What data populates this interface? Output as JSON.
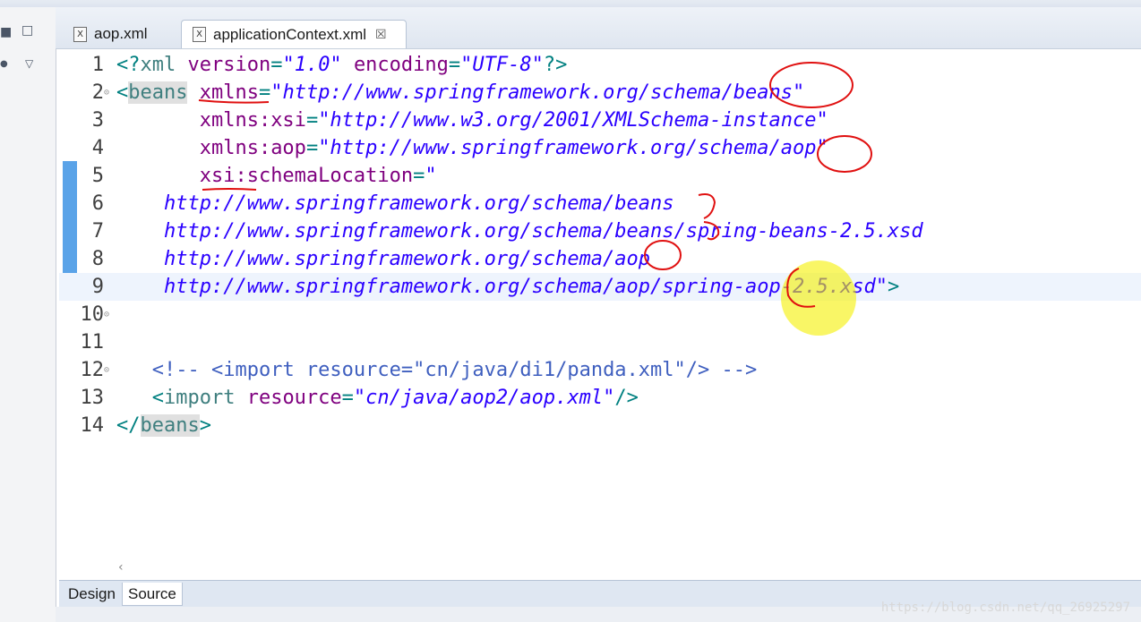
{
  "tabs": [
    {
      "label": "aop.xml",
      "active": false
    },
    {
      "label": "applicationContext.xml",
      "active": true,
      "close": "☒"
    }
  ],
  "lines": [
    {
      "num": "1",
      "parts": [
        [
          "punc",
          "<?"
        ],
        [
          "tag",
          "xml "
        ],
        [
          "attr",
          "version"
        ],
        [
          "punc",
          "="
        ],
        [
          "val",
          "\"1.0\""
        ],
        [
          "punc",
          " "
        ],
        [
          "attr",
          "encoding"
        ],
        [
          "punc",
          "="
        ],
        [
          "val",
          "\"UTF-8\""
        ],
        [
          "punc",
          "?>"
        ]
      ]
    },
    {
      "num": "2",
      "fold": true,
      "parts": [
        [
          "punc",
          "<"
        ],
        [
          "tag-hl",
          "beans"
        ],
        [
          "punc",
          " "
        ],
        [
          "attr",
          "xmlns"
        ],
        [
          "punc",
          "="
        ],
        [
          "val",
          "\"http://www.springframework.org/schema/beans\""
        ]
      ]
    },
    {
      "num": "3",
      "parts": [
        [
          "punc",
          "       "
        ],
        [
          "attr",
          "xmlns:xsi"
        ],
        [
          "punc",
          "="
        ],
        [
          "val",
          "\"http://www.w3.org/2001/XMLSchema-instance\""
        ]
      ]
    },
    {
      "num": "4",
      "parts": [
        [
          "punc",
          "       "
        ],
        [
          "attr",
          "xmlns:aop"
        ],
        [
          "punc",
          "="
        ],
        [
          "val",
          "\"http://www.springframework.org/schema/aop\""
        ]
      ]
    },
    {
      "num": "5",
      "parts": [
        [
          "punc",
          "       "
        ],
        [
          "attr",
          "xsi:schemaLocation"
        ],
        [
          "punc",
          "="
        ],
        [
          "val",
          "\""
        ]
      ]
    },
    {
      "num": "6",
      "parts": [
        [
          "punc",
          "    "
        ],
        [
          "val",
          "http://www.springframework.org/schema/beans"
        ]
      ]
    },
    {
      "num": "7",
      "parts": [
        [
          "punc",
          "    "
        ],
        [
          "val",
          "http://www.springframework.org/schema/beans/spring-beans-2.5.xsd"
        ]
      ]
    },
    {
      "num": "8",
      "parts": [
        [
          "punc",
          "    "
        ],
        [
          "val",
          "http://www.springframework.org/schema/aop"
        ]
      ]
    },
    {
      "num": "9",
      "current": true,
      "parts": [
        [
          "punc",
          "    "
        ],
        [
          "val",
          "http://www.springframework.org/schema/aop/spring-aop-2.5.xsd\""
        ],
        [
          "punc",
          ">"
        ]
      ]
    },
    {
      "num": "10",
      "fold": true,
      "parts": []
    },
    {
      "num": "11",
      "parts": []
    },
    {
      "num": "12",
      "fold": true,
      "parts": [
        [
          "punc",
          "   "
        ],
        [
          "cmt",
          "<!-- <import resource=\"cn/java/di1/panda.xml\"/> -->"
        ]
      ]
    },
    {
      "num": "13",
      "parts": [
        [
          "punc",
          "   <"
        ],
        [
          "tag",
          "import "
        ],
        [
          "attr",
          "resource"
        ],
        [
          "punc",
          "="
        ],
        [
          "val",
          "\"cn/java/aop2/aop.xml\""
        ],
        [
          "punc",
          "/>"
        ]
      ]
    },
    {
      "num": "14",
      "parts": [
        [
          "punc",
          "</"
        ],
        [
          "tag-hl",
          "beans"
        ],
        [
          "punc",
          ">"
        ]
      ]
    }
  ],
  "bottom_tabs": {
    "design": "Design",
    "source": "Source"
  },
  "watermark": "https://blog.csdn.net/qq_26925297",
  "colors": {
    "tag": "#3f7f7f",
    "attr": "#7f007f",
    "value": "#2a00ff",
    "comment": "#3f5fbf",
    "annotation": "#e01010",
    "highlight": "#f5f000"
  }
}
